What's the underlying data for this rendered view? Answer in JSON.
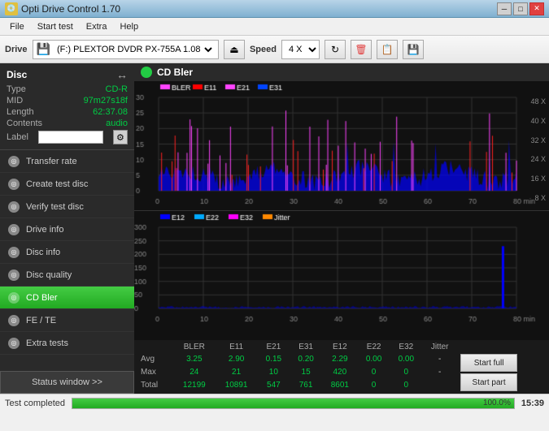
{
  "app": {
    "title": "Opti Drive Control 1.70",
    "icon": "💿"
  },
  "titlebar": {
    "minimize": "─",
    "maximize": "□",
    "close": "✕"
  },
  "menubar": {
    "items": [
      "File",
      "Start test",
      "Extra",
      "Help"
    ]
  },
  "toolbar": {
    "drive_label": "Drive",
    "drive_value": "(F:)  PLEXTOR DVDR  PX-755A 1.08",
    "speed_label": "Speed",
    "speed_value": "4 X"
  },
  "disc": {
    "title": "Disc",
    "type_label": "Type",
    "type_value": "CD-R",
    "mid_label": "MID",
    "mid_value": "97m27s18f",
    "length_label": "Length",
    "length_value": "62:37.08",
    "contents_label": "Contents",
    "contents_value": "audio",
    "label_label": "Label",
    "label_value": ""
  },
  "nav": {
    "items": [
      {
        "id": "transfer-rate",
        "label": "Transfer rate",
        "active": false
      },
      {
        "id": "create-test-disc",
        "label": "Create test disc",
        "active": false
      },
      {
        "id": "verify-test-disc",
        "label": "Verify test disc",
        "active": false
      },
      {
        "id": "drive-info",
        "label": "Drive info",
        "active": false
      },
      {
        "id": "disc-info",
        "label": "Disc info",
        "active": false
      },
      {
        "id": "disc-quality",
        "label": "Disc quality",
        "active": false
      },
      {
        "id": "cd-bler",
        "label": "CD Bler",
        "active": true
      },
      {
        "id": "fe-te",
        "label": "FE / TE",
        "active": false
      },
      {
        "id": "extra-tests",
        "label": "Extra tests",
        "active": false
      }
    ],
    "status_window": "Status window >>"
  },
  "chart": {
    "title": "CD Bler",
    "upper": {
      "legend": [
        {
          "id": "BLER",
          "color": "#ff44ff"
        },
        {
          "id": "E11",
          "color": "#ff0000"
        },
        {
          "id": "E21",
          "color": "#ff44ff"
        },
        {
          "id": "E31",
          "color": "#0044ff"
        }
      ],
      "y_labels_left": [
        "30",
        "25",
        "20",
        "15",
        "10",
        "5",
        "0"
      ],
      "y_labels_right": [
        "48 X",
        "40 X",
        "32 X",
        "24 X",
        "16 X",
        "8 X"
      ],
      "x_labels": [
        "0",
        "10",
        "20",
        "30",
        "40",
        "50",
        "60",
        "70",
        "80 min"
      ]
    },
    "lower": {
      "legend": [
        {
          "id": "E12",
          "color": "#0000ff"
        },
        {
          "id": "E22",
          "color": "#00aaff"
        },
        {
          "id": "E32",
          "color": "#ff00ff"
        },
        {
          "id": "Jitter",
          "color": "#ff8800"
        }
      ],
      "y_labels_left": [
        "300",
        "250",
        "200",
        "150",
        "100",
        "50",
        "0"
      ],
      "x_labels": [
        "0",
        "10",
        "20",
        "30",
        "40",
        "50",
        "60",
        "70",
        "80 min"
      ]
    }
  },
  "stats": {
    "columns": [
      "",
      "BLER",
      "E11",
      "E21",
      "E31",
      "E12",
      "E22",
      "E32",
      "Jitter",
      "",
      ""
    ],
    "rows": [
      {
        "label": "Avg",
        "bler": "3.25",
        "e11": "2.90",
        "e21": "0.15",
        "e31": "0.20",
        "e12": "2.29",
        "e22": "0.00",
        "e32": "0.00",
        "jitter": "-"
      },
      {
        "label": "Max",
        "bler": "24",
        "e11": "21",
        "e21": "10",
        "e31": "15",
        "e12": "420",
        "e22": "0",
        "e32": "0",
        "jitter": "-"
      },
      {
        "label": "Total",
        "bler": "12199",
        "e11": "10891",
        "e21": "547",
        "e31": "761",
        "e12": "8601",
        "e22": "0",
        "e32": "0",
        "jitter": ""
      }
    ],
    "start_full": "Start full",
    "start_part": "Start part"
  },
  "statusbar": {
    "text": "Test completed",
    "progress": 100,
    "progress_label": "100.0%",
    "time": "15:39"
  }
}
